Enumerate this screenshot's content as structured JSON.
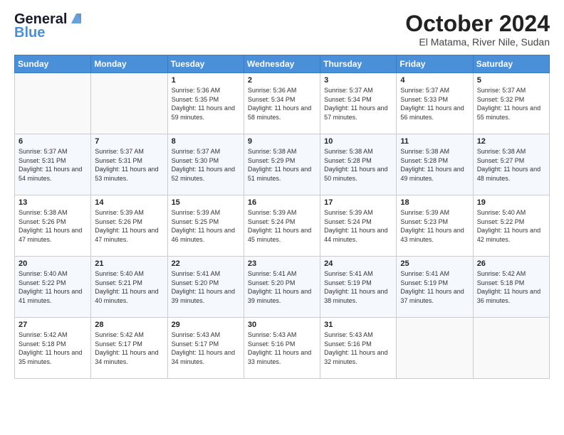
{
  "header": {
    "logo_line1": "General",
    "logo_line2": "Blue",
    "month_title": "October 2024",
    "location": "El Matama, River Nile, Sudan"
  },
  "days_of_week": [
    "Sunday",
    "Monday",
    "Tuesday",
    "Wednesday",
    "Thursday",
    "Friday",
    "Saturday"
  ],
  "weeks": [
    [
      {
        "day": "",
        "content": ""
      },
      {
        "day": "",
        "content": ""
      },
      {
        "day": "1",
        "content": "Sunrise: 5:36 AM\nSunset: 5:35 PM\nDaylight: 11 hours and 59 minutes."
      },
      {
        "day": "2",
        "content": "Sunrise: 5:36 AM\nSunset: 5:34 PM\nDaylight: 11 hours and 58 minutes."
      },
      {
        "day": "3",
        "content": "Sunrise: 5:37 AM\nSunset: 5:34 PM\nDaylight: 11 hours and 57 minutes."
      },
      {
        "day": "4",
        "content": "Sunrise: 5:37 AM\nSunset: 5:33 PM\nDaylight: 11 hours and 56 minutes."
      },
      {
        "day": "5",
        "content": "Sunrise: 5:37 AM\nSunset: 5:32 PM\nDaylight: 11 hours and 55 minutes."
      }
    ],
    [
      {
        "day": "6",
        "content": "Sunrise: 5:37 AM\nSunset: 5:31 PM\nDaylight: 11 hours and 54 minutes."
      },
      {
        "day": "7",
        "content": "Sunrise: 5:37 AM\nSunset: 5:31 PM\nDaylight: 11 hours and 53 minutes."
      },
      {
        "day": "8",
        "content": "Sunrise: 5:37 AM\nSunset: 5:30 PM\nDaylight: 11 hours and 52 minutes."
      },
      {
        "day": "9",
        "content": "Sunrise: 5:38 AM\nSunset: 5:29 PM\nDaylight: 11 hours and 51 minutes."
      },
      {
        "day": "10",
        "content": "Sunrise: 5:38 AM\nSunset: 5:28 PM\nDaylight: 11 hours and 50 minutes."
      },
      {
        "day": "11",
        "content": "Sunrise: 5:38 AM\nSunset: 5:28 PM\nDaylight: 11 hours and 49 minutes."
      },
      {
        "day": "12",
        "content": "Sunrise: 5:38 AM\nSunset: 5:27 PM\nDaylight: 11 hours and 48 minutes."
      }
    ],
    [
      {
        "day": "13",
        "content": "Sunrise: 5:38 AM\nSunset: 5:26 PM\nDaylight: 11 hours and 47 minutes."
      },
      {
        "day": "14",
        "content": "Sunrise: 5:39 AM\nSunset: 5:26 PM\nDaylight: 11 hours and 47 minutes."
      },
      {
        "day": "15",
        "content": "Sunrise: 5:39 AM\nSunset: 5:25 PM\nDaylight: 11 hours and 46 minutes."
      },
      {
        "day": "16",
        "content": "Sunrise: 5:39 AM\nSunset: 5:24 PM\nDaylight: 11 hours and 45 minutes."
      },
      {
        "day": "17",
        "content": "Sunrise: 5:39 AM\nSunset: 5:24 PM\nDaylight: 11 hours and 44 minutes."
      },
      {
        "day": "18",
        "content": "Sunrise: 5:39 AM\nSunset: 5:23 PM\nDaylight: 11 hours and 43 minutes."
      },
      {
        "day": "19",
        "content": "Sunrise: 5:40 AM\nSunset: 5:22 PM\nDaylight: 11 hours and 42 minutes."
      }
    ],
    [
      {
        "day": "20",
        "content": "Sunrise: 5:40 AM\nSunset: 5:22 PM\nDaylight: 11 hours and 41 minutes."
      },
      {
        "day": "21",
        "content": "Sunrise: 5:40 AM\nSunset: 5:21 PM\nDaylight: 11 hours and 40 minutes."
      },
      {
        "day": "22",
        "content": "Sunrise: 5:41 AM\nSunset: 5:20 PM\nDaylight: 11 hours and 39 minutes."
      },
      {
        "day": "23",
        "content": "Sunrise: 5:41 AM\nSunset: 5:20 PM\nDaylight: 11 hours and 39 minutes."
      },
      {
        "day": "24",
        "content": "Sunrise: 5:41 AM\nSunset: 5:19 PM\nDaylight: 11 hours and 38 minutes."
      },
      {
        "day": "25",
        "content": "Sunrise: 5:41 AM\nSunset: 5:19 PM\nDaylight: 11 hours and 37 minutes."
      },
      {
        "day": "26",
        "content": "Sunrise: 5:42 AM\nSunset: 5:18 PM\nDaylight: 11 hours and 36 minutes."
      }
    ],
    [
      {
        "day": "27",
        "content": "Sunrise: 5:42 AM\nSunset: 5:18 PM\nDaylight: 11 hours and 35 minutes."
      },
      {
        "day": "28",
        "content": "Sunrise: 5:42 AM\nSunset: 5:17 PM\nDaylight: 11 hours and 34 minutes."
      },
      {
        "day": "29",
        "content": "Sunrise: 5:43 AM\nSunset: 5:17 PM\nDaylight: 11 hours and 34 minutes."
      },
      {
        "day": "30",
        "content": "Sunrise: 5:43 AM\nSunset: 5:16 PM\nDaylight: 11 hours and 33 minutes."
      },
      {
        "day": "31",
        "content": "Sunrise: 5:43 AM\nSunset: 5:16 PM\nDaylight: 11 hours and 32 minutes."
      },
      {
        "day": "",
        "content": ""
      },
      {
        "day": "",
        "content": ""
      }
    ]
  ]
}
